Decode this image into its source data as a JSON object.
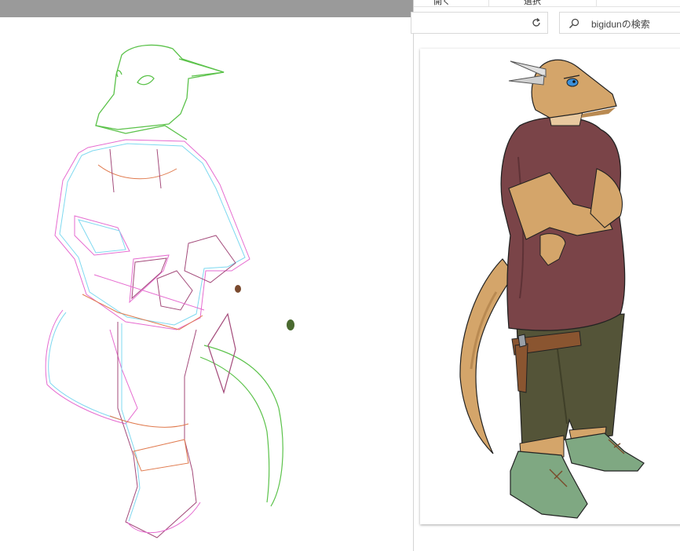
{
  "left_canvas": {
    "topbar_color": "#9a9a9a",
    "sketch_line_colors": [
      "#5bc24a",
      "#e07a4e",
      "#7fd9f0",
      "#e66bd0",
      "#a34a7a"
    ],
    "paint_dots": [
      "#7a4a2e",
      "#4a6a30"
    ]
  },
  "explorer": {
    "menu_tabs": [
      {
        "label": "開く"
      },
      {
        "label": "選択"
      }
    ],
    "address": {
      "dropdown_icon": "chevron-down-icon",
      "refresh_icon": "refresh-icon"
    },
    "search": {
      "placeholder": "bigidunの検索",
      "icon": "search-icon"
    },
    "preview": {
      "subject": "colored kobold character illustration",
      "colors": {
        "skin": "#d4a56a",
        "shirt": "#7a4448",
        "pants": "#545438",
        "boots": "#7fa882",
        "belt": "#8a5530",
        "horn": "#d8d8d8",
        "eye": "#3b8fd9"
      }
    }
  }
}
